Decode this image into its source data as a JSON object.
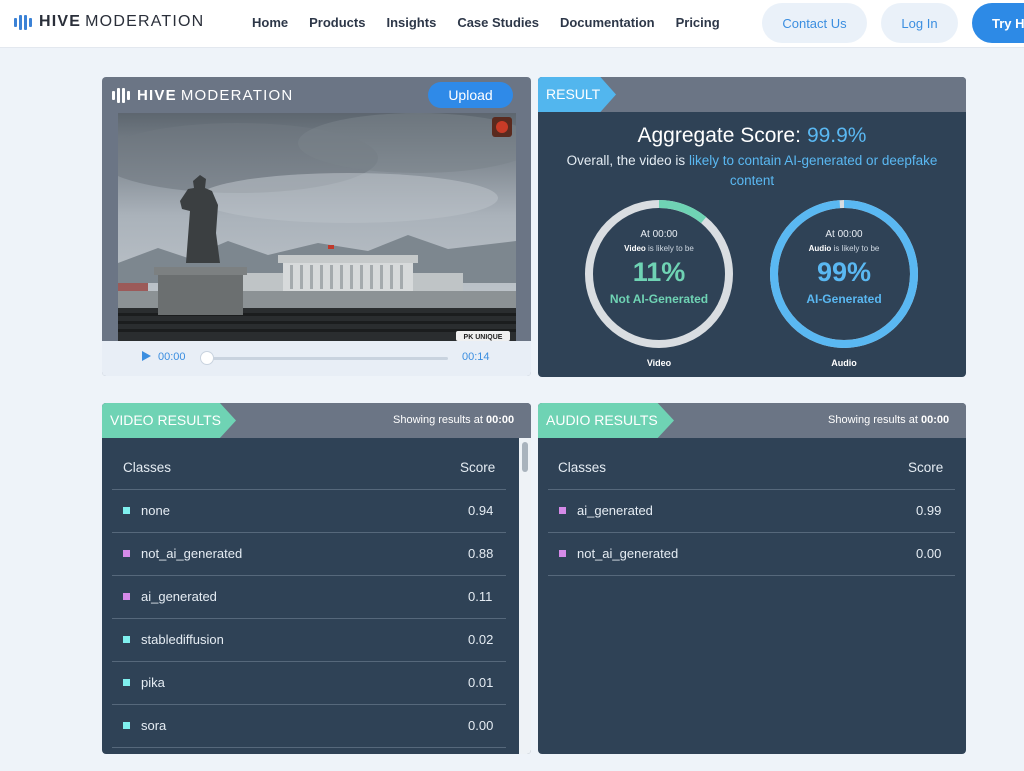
{
  "nav": {
    "brand_bold": "HIVE",
    "brand_light": "MODERATION",
    "links": [
      "Home",
      "Products",
      "Insights",
      "Case Studies",
      "Documentation",
      "Pricing"
    ],
    "contact": "Contact Us",
    "login": "Log In",
    "try": "Try H"
  },
  "upload_panel": {
    "brand_bold": "HIVE",
    "brand_light": "MODERATION",
    "upload_label": "Upload",
    "current_time": "00:00",
    "end_time": "00:14",
    "progress": 0
  },
  "result": {
    "tag": "RESULT",
    "aggregate_label": "Aggregate Score:",
    "aggregate_value": "99.9%",
    "overall_prefix": "Overall, the video is",
    "overall_highlight": "likely to contain AI-generated or deepfake content",
    "video_gauge": {
      "at": "At 00:00",
      "subject": "Video",
      "sub_rest": "is likely to be",
      "pct": "11%",
      "fraction": 0.11,
      "verdict": "Not AI-Generated",
      "caption": "Video",
      "color": "#6fd3b4"
    },
    "audio_gauge": {
      "at": "At 00:00",
      "subject": "Audio",
      "sub_rest": "is likely to be",
      "pct": "99%",
      "fraction": 0.99,
      "verdict": "AI-Generated",
      "caption": "Audio",
      "color": "#5ab8f2"
    }
  },
  "video_results": {
    "tag": "VIDEO RESULTS",
    "showing_prefix": "Showing results at",
    "showing_time": "00:00",
    "col_classes": "Classes",
    "col_score": "Score",
    "rows": [
      {
        "cls": "none",
        "score": "0.94",
        "color": "#7ff0ef"
      },
      {
        "cls": "not_ai_generated",
        "score": "0.88",
        "color": "#d58ae8"
      },
      {
        "cls": "ai_generated",
        "score": "0.11",
        "color": "#d58ae8"
      },
      {
        "cls": "stablediffusion",
        "score": "0.02",
        "color": "#7ff0ef"
      },
      {
        "cls": "pika",
        "score": "0.01",
        "color": "#7ff0ef"
      },
      {
        "cls": "sora",
        "score": "0.00",
        "color": "#7ff0ef"
      }
    ]
  },
  "audio_results": {
    "tag": "AUDIO RESULTS",
    "showing_prefix": "Showing results at",
    "showing_time": "00:00",
    "col_classes": "Classes",
    "col_score": "Score",
    "rows": [
      {
        "cls": "ai_generated",
        "score": "0.99",
        "color": "#d58ae8"
      },
      {
        "cls": "not_ai_generated",
        "score": "0.00",
        "color": "#d58ae8"
      }
    ]
  },
  "video_frame": {
    "watermark": "PK UNIQUE"
  }
}
